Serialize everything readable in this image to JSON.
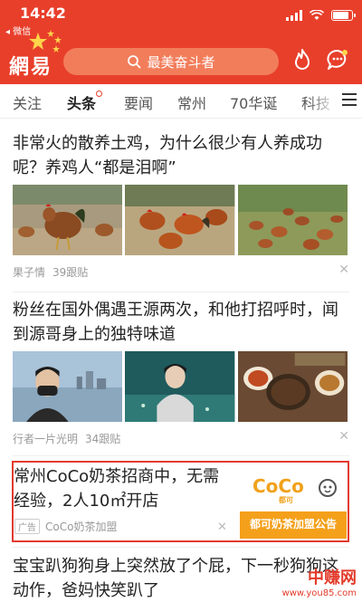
{
  "status": {
    "time": "14:42",
    "back_label": "◂ 微信"
  },
  "header": {
    "logo_text": "網易",
    "search_placeholder": "最美奋斗者"
  },
  "tabs": [
    {
      "label": "关注"
    },
    {
      "label": "头条",
      "active": true
    },
    {
      "label": "要闻"
    },
    {
      "label": "常州"
    },
    {
      "label": "70华诞"
    },
    {
      "label": "科技"
    }
  ],
  "articles": [
    {
      "title": "非常火的散养土鸡，为什么很少有人养成功呢？养鸡人“都是泪啊”",
      "source": "果子情",
      "comments": "39跟贴",
      "images": [
        "chicken-photo",
        "chicken-flock-photo",
        "chicken-farm-photo"
      ]
    },
    {
      "title": "粉丝在国外偶遇王源两次，和他打招呼时，闻到源哥身上的独特味道",
      "source": "行者一片光明",
      "comments": "34跟贴",
      "images": [
        "masked-man-photo",
        "singer-photo",
        "food-photo"
      ]
    },
    {
      "title": "宝宝趴狗狗身上突然放了个屁，下一秒狗狗这动作，爸妈快笑趴了"
    }
  ],
  "ad": {
    "title": "常州CoCo奶茶招商中，无需经验，2人10㎡开店",
    "badge": "广告",
    "source": "CoCo奶茶加盟",
    "image_brand": "CoCo",
    "image_brand_sub": "都可",
    "image_caption": "都可奶茶加盟公告"
  },
  "watermark": {
    "name": "中赚网",
    "url": "www.you85.com"
  },
  "colors": {
    "brand_red": "#e83f2b",
    "search_bg": "#f27d5b",
    "ad_border": "#e23a30",
    "coco_orange": "#f4a01b"
  }
}
